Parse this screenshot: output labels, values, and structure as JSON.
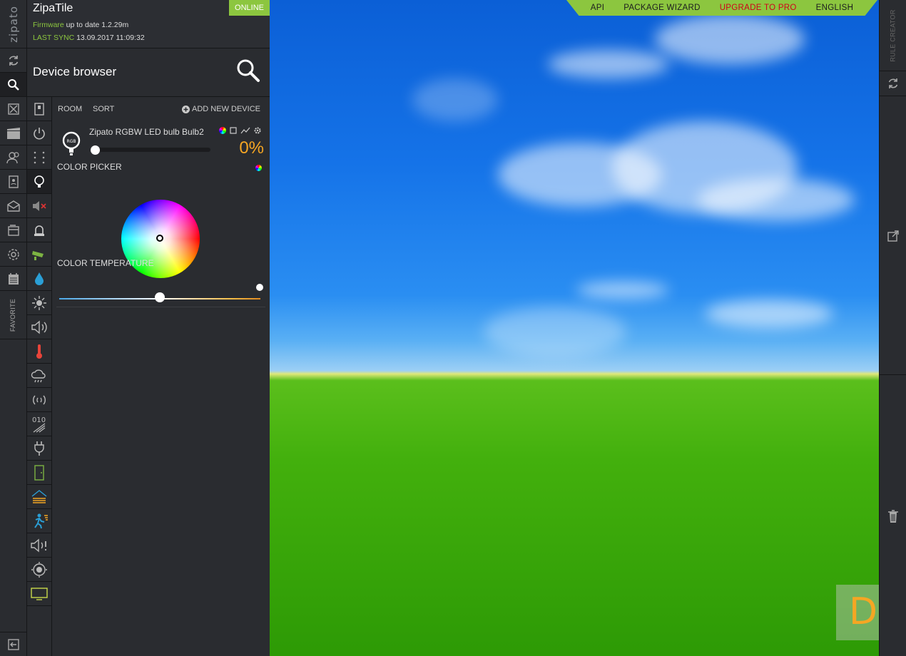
{
  "app": {
    "logo": "zipato",
    "title": "ZipaTile",
    "status": "ONLINE",
    "firmware_label": "Firmware",
    "firmware_text": "up to date 1.2.29m",
    "last_sync_label": "LAST SYNC",
    "last_sync_value": "13.09.2017 11:09:32"
  },
  "left_rail": {
    "items": [
      "refresh-icon",
      "search-icon",
      "widgets-icon",
      "scenes-icon",
      "users-icon",
      "contacts-icon",
      "messages-icon",
      "wallet-icon",
      "settings-icon",
      "calendar-icon"
    ],
    "favorite_label": "FAVORITE",
    "bottom_icon": "logout-icon"
  },
  "device_browser": {
    "title": "Device browser",
    "search_icon": "magnifier-icon"
  },
  "categories": [
    "switch-icon",
    "power-icon",
    "grid-icon",
    "bulb-icon",
    "mute-icon",
    "alarm-light-icon",
    "camera-icon",
    "water-drop-icon",
    "brightness-icon",
    "speaker-icon",
    "thermometer-icon",
    "weather-icon",
    "signal-icon",
    "binary-icon",
    "plug-icon",
    "door-icon",
    "flood-icon",
    "motion-icon",
    "siren-icon",
    "smoke-icon",
    "tv-icon"
  ],
  "toolbar": {
    "room": "ROOM",
    "sort": "SORT",
    "add": "ADD NEW DEVICE"
  },
  "device": {
    "name": "Zipato RGBW LED bulb Bulb2",
    "level_text": "0%",
    "level": 0,
    "color_picker_label": "COLOR PICKER",
    "color_temperature_label": "COLOR TEMPERATURE",
    "color_temperature_level": 0.5,
    "colors": {
      "level": "#f5a623",
      "accent": "#8cc63f"
    }
  },
  "top_nav": {
    "items": [
      "API",
      "PACKAGE WIZARD",
      "UPGRADE TO PRO",
      "ENGLISH"
    ],
    "highlight_color": "#d0021b",
    "bg_color": "#8cc63f"
  },
  "right_rail": {
    "rule_creator": "RULE CREATOR",
    "icons": [
      "refresh-icon",
      "external-link-icon",
      "trash-icon"
    ]
  },
  "tile": {
    "letter": "D"
  }
}
